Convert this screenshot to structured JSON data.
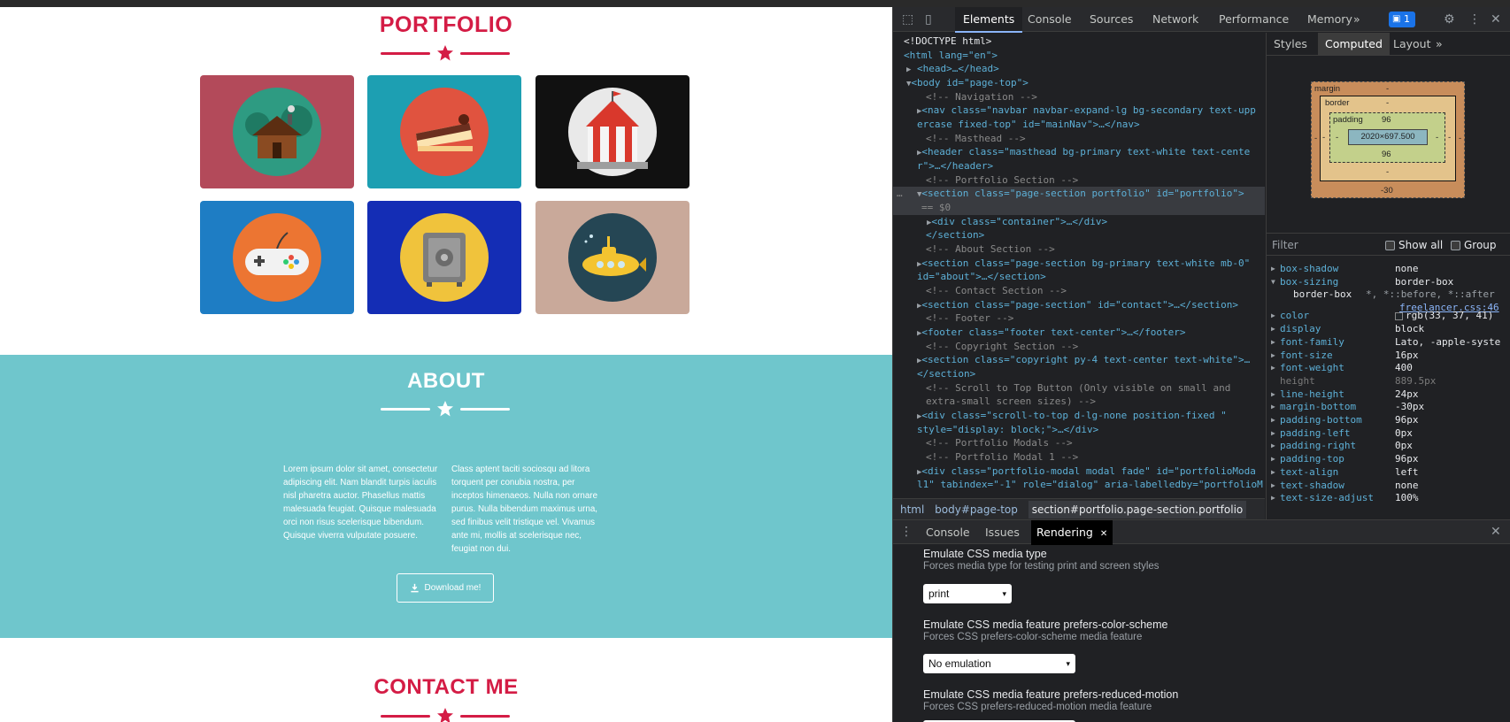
{
  "site": {
    "portfolio_title": "PORTFOLIO",
    "portfolio_items": [
      {
        "icon": "cabin-icon",
        "bg": "#b34a5a",
        "circle": "#2e9b82"
      },
      {
        "icon": "cake-icon",
        "bg": "#1d9fb2",
        "circle": "#e0533f"
      },
      {
        "icon": "circus-tent-icon",
        "bg": "#111111",
        "circle": "#e9e9e9"
      },
      {
        "icon": "game-controller-icon",
        "bg": "#1e7dc4",
        "circle": "#ec7532"
      },
      {
        "icon": "safe-icon",
        "bg": "#142db5",
        "circle": "#f0c33c"
      },
      {
        "icon": "submarine-icon",
        "bg": "#c9a99a",
        "circle": "#254654"
      }
    ],
    "about_title": "ABOUT",
    "about_left": "Lorem ipsum dolor sit amet, consectetur adipiscing elit. Nam blandit turpis iaculis nisl pharetra auctor. Phasellus mattis malesuada feugiat. Quisque malesuada orci non risus scelerisque bibendum. Quisque viverra vulputate posuere.",
    "about_right": "Class aptent taciti sociosqu ad litora torquent per conubia nostra, per inceptos himenaeos. Nulla non ornare purus. Nulla bibendum maximus urna, sed finibus velit tristique vel. Vivamus ante mi, mollis at scelerisque nec, feugiat non dui.",
    "download_label": "Download me!",
    "contact_title": "CONTACT ME",
    "colors": {
      "primary_red": "#d41c45",
      "about_bg": "#6fc6cc"
    }
  },
  "devtools": {
    "tabs": [
      "Elements",
      "Console",
      "Sources",
      "Network",
      "Performance",
      "Memory"
    ],
    "more_tabs": "»",
    "issues_badge": "1",
    "dom_lines": [
      "<!DOCTYPE html>",
      "<html lang=\"en\">",
      "<head>…</head>",
      "<body id=\"page-top\">",
      "<!-- Navigation -->",
      "<nav class=\"navbar navbar-expand-lg bg-secondary text-upp",
      "ercase fixed-top\" id=\"mainNav\">…</nav>",
      "<!-- Masthead -->",
      "<header class=\"masthead bg-primary text-white text-cente",
      "r\">…</header>",
      "<!-- Portfolio Section -->",
      "<section class=\"page-section portfolio\" id=\"portfolio\">",
      "== $0",
      "<div class=\"container\">…</div>",
      "</section>",
      "<!-- About Section -->",
      "<section class=\"page-section bg-primary text-white mb-0\"",
      "id=\"about\">…</section>",
      "<!-- Contact Section -->",
      "<section class=\"page-section\" id=\"contact\">…</section>",
      "<!-- Footer -->",
      "<footer class=\"footer text-center\">…</footer>",
      "<!-- Copyright Section -->",
      "<section class=\"copyright py-4 text-center text-white\">…",
      "</section>",
      "<!-- Scroll to Top Button (Only visible on small and",
      "extra-small screen sizes) -->",
      "<div class=\"scroll-to-top d-lg-none position-fixed \"",
      "style=\"display: block;\">…</div>",
      "<!-- Portfolio Modals -->",
      "<!-- Portfolio Modal 1 -->",
      "<div class=\"portfolio-modal modal fade\" id=\"portfolioModa",
      "l1\" tabindex=\"-1\" role=\"dialog\" aria-labelledby=\"portfolioM"
    ],
    "breadcrumbs": [
      "html",
      "body#page-top",
      "section#portfolio.page-section.portfolio"
    ],
    "side_tabs": [
      "Styles",
      "Computed",
      "Layout",
      "»"
    ],
    "box_model": {
      "margin_label": "margin",
      "margin_top": "-",
      "margin_bottom": "-30",
      "margin_left": "-",
      "margin_right": "-",
      "border_label": "border",
      "border_top": "-",
      "border_bottom": "-",
      "border_left": "-",
      "border_right": "-",
      "padding_label": "padding",
      "padding_top": "96",
      "padding_bottom": "96",
      "padding_left": "-",
      "padding_right": "-",
      "content": "2020×697.500"
    },
    "filter_placeholder": "Filter",
    "show_all": "Show all",
    "group": "Group",
    "computed": [
      {
        "name": "box-shadow",
        "value": "none"
      },
      {
        "name": "box-sizing",
        "value": "border-box",
        "expanded": true
      },
      {
        "name": "color",
        "value": "rgb(33, 37, 41)"
      },
      {
        "name": "display",
        "value": "block"
      },
      {
        "name": "font-family",
        "value": "Lato, -apple-syste"
      },
      {
        "name": "font-size",
        "value": "16px"
      },
      {
        "name": "font-weight",
        "value": "400"
      },
      {
        "name": "height",
        "value": "889.5px",
        "dim": true
      },
      {
        "name": "line-height",
        "value": "24px"
      },
      {
        "name": "margin-bottom",
        "value": "-30px"
      },
      {
        "name": "padding-bottom",
        "value": "96px"
      },
      {
        "name": "padding-left",
        "value": "0px"
      },
      {
        "name": "padding-right",
        "value": "0px"
      },
      {
        "name": "padding-top",
        "value": "96px"
      },
      {
        "name": "text-align",
        "value": "left"
      },
      {
        "name": "text-shadow",
        "value": "none"
      },
      {
        "name": "text-size-adjust",
        "value": "100%"
      }
    ],
    "box_sizing_sub": {
      "value": "border-box",
      "selector": "*, *::before, *::after",
      "source": "freelancer.css:46"
    },
    "drawer_tabs": [
      "Console",
      "Issues",
      "Rendering"
    ],
    "rendering": [
      {
        "heading": "Emulate CSS media type",
        "desc": "Forces media type for testing print and screen styles",
        "value": "print"
      },
      {
        "heading": "Emulate CSS media feature prefers-color-scheme",
        "desc": "Forces CSS prefers-color-scheme media feature",
        "value": "No emulation"
      },
      {
        "heading": "Emulate CSS media feature prefers-reduced-motion",
        "desc": "Forces CSS prefers-reduced-motion media feature",
        "value": ""
      }
    ]
  }
}
